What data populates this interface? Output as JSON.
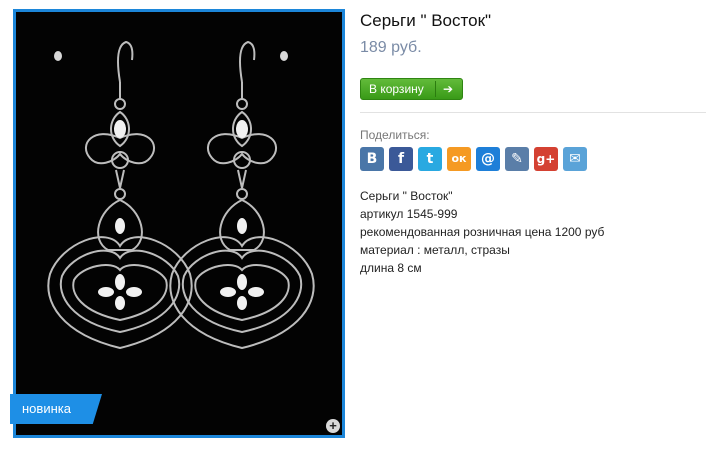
{
  "product": {
    "title": "Серьги \" Восток\"",
    "price": "189 руб.",
    "badge": "новинка"
  },
  "cart": {
    "label": "В корзину",
    "arrow": "➔"
  },
  "zoom": {
    "icon": "+"
  },
  "share": {
    "label": "Поделиться:",
    "icons": [
      {
        "name": "vkontakte-icon",
        "glyph": "В",
        "color": "#4a76a8"
      },
      {
        "name": "facebook-icon",
        "glyph": "f",
        "color": "#3b5998"
      },
      {
        "name": "twitter-icon",
        "glyph": "t",
        "color": "#29a9e1"
      },
      {
        "name": "odnoklassniki-icon",
        "glyph": "ок",
        "color": "#f59a23"
      },
      {
        "name": "mailru-icon",
        "glyph": "@",
        "color": "#1e7fd8"
      },
      {
        "name": "livejournal-icon",
        "glyph": "✎",
        "color": "#5a7ea8"
      },
      {
        "name": "google-plus-icon",
        "glyph": "g+",
        "color": "#d44132"
      },
      {
        "name": "email-icon",
        "glyph": "✉",
        "color": "#5aa3d8"
      }
    ]
  },
  "description": {
    "lines": [
      "Серьги \" Восток\"",
      "артикул 1545-999",
      "рекомендованная розничная цена 1200 руб",
      "материал : металл, стразы",
      "длина 8 см"
    ]
  }
}
